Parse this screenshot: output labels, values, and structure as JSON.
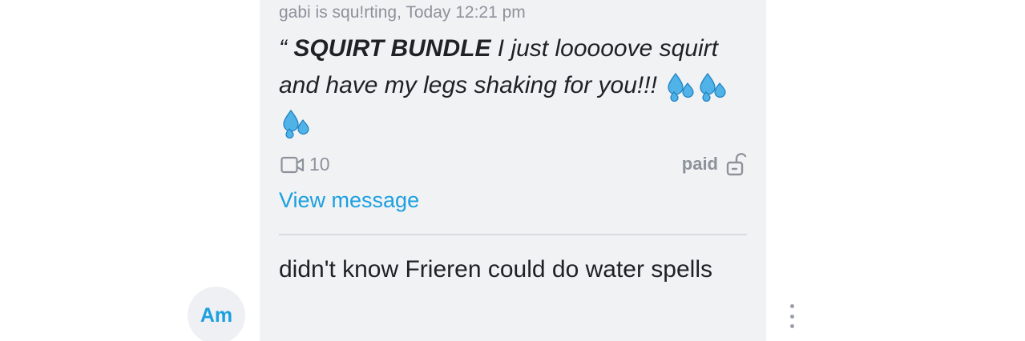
{
  "avatar": {
    "initials": "Am"
  },
  "quoted_message": {
    "header": "gabi is squ!rting, Today 12:21 pm",
    "quote_mark": "“ ",
    "bold_title": "SQUIRT BUNDLE",
    "body": " I just looooove squirt and have my legs shaking for you!!! ",
    "emoji": "💦💦💦",
    "video_count": "10",
    "paid_label": "paid",
    "view_link": "View message"
  },
  "reply": {
    "text": "didn't know Frieren could do water spells"
  },
  "icons": {
    "video": "video-camera-icon",
    "lock": "unlocked-padlock-icon",
    "drops": "sweat-droplets-icon",
    "more": "vertical-ellipsis-icon"
  },
  "colors": {
    "accent": "#1ba0e0",
    "bubble_bg": "#f1f2f4",
    "muted_text": "#8d929b",
    "body_text": "#1f2125"
  }
}
